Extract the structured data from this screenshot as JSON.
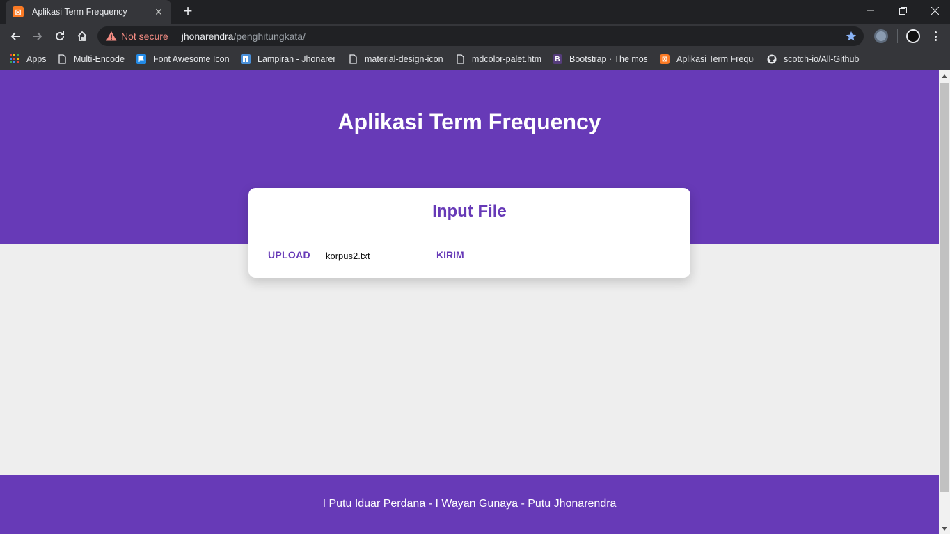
{
  "browser": {
    "tab_title": "Aplikasi Term Frequency",
    "tab_favicon_glyph": "⊠",
    "security_label": "Not secure",
    "url_host": "jhonarendra",
    "url_path": "/penghitungkata/",
    "bookmarks": [
      {
        "label": "Apps",
        "icon": "apps-grid-icon"
      },
      {
        "label": "Multi-Encoder",
        "icon": "page-icon"
      },
      {
        "label": "Font Awesome Icons",
        "icon": "flag-icon"
      },
      {
        "label": "Lampiran - Jhonarend",
        "icon": "blogger-icon"
      },
      {
        "label": "material-design-icon",
        "icon": "page-icon"
      },
      {
        "label": "mdcolor-palet.html",
        "icon": "page-icon"
      },
      {
        "label": "Bootstrap · The most",
        "icon": "bootstrap-icon"
      },
      {
        "label": "Aplikasi Term Frequen",
        "icon": "xampp-icon"
      },
      {
        "label": "scotch-io/All-Github-",
        "icon": "github-icon"
      }
    ]
  },
  "page": {
    "title": "Aplikasi Term Frequency",
    "card": {
      "heading": "Input File",
      "upload_label": "UPLOAD",
      "file_name": "korpus2.txt",
      "submit_label": "KIRIM"
    },
    "footer": {
      "names": "I Putu Iduar Perdana - I Wayan Gunaya - Putu Jhonarendra"
    }
  },
  "colors": {
    "primary": "#673ab7",
    "background": "#eeeeee",
    "card": "#ffffff"
  }
}
